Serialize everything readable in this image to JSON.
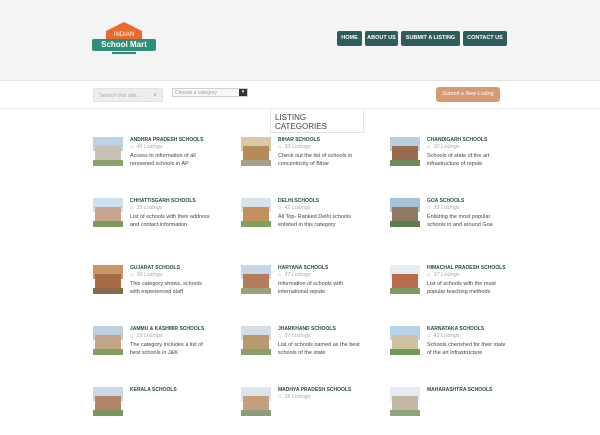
{
  "logo": {
    "line1": "INDIAN",
    "line2": "School Mart"
  },
  "nav": [
    {
      "label": "HOME"
    },
    {
      "label": "ABOUT US"
    },
    {
      "label": "SUBMIT A LISTING"
    },
    {
      "label": "CONTACT US"
    }
  ],
  "search": {
    "placeholder": "Search this site..."
  },
  "category_select": {
    "selected": "Choose a category"
  },
  "submit_button": "Submit a New Listing",
  "categories_title": "LISTING CATEGORIES",
  "icon": "tag-icon",
  "colors": {
    "nav_button": "#2f5b5b",
    "submit_button": "#d59a72",
    "heading": "#2a4a4a",
    "logo_green": "#2e8f78",
    "logo_orange": "#e86a2c"
  },
  "listings": [
    {
      "name": "ANDHRA PRADESH SCHOOLS",
      "count": "45 Listings",
      "desc": "Access to information of all renowned schools in AP"
    },
    {
      "name": "BIHAR SCHOOLS",
      "count": "33 Listings",
      "desc": "Check out the list of schools in concentricity of Bihar"
    },
    {
      "name": "CHANDIGARH SCHOOLS",
      "count": "30 Listings",
      "desc": "Schools of state of the art infrastructure of repute"
    },
    {
      "name": "CHHATTISGARH SCHOOLS",
      "count": "33 Listings",
      "desc": "List of schools with their address and contact information"
    },
    {
      "name": "DELHI SCHOOLS",
      "count": "42 Listings",
      "desc": "All Top- Ranked Delhi schools enlisted in this category"
    },
    {
      "name": "GOA SCHOOLS",
      "count": "33 Listings",
      "desc": "Enlisting the most popular schools in and around Goa"
    },
    {
      "name": "GUJARAT SCHOOLS",
      "count": "36 Listings",
      "desc": "This category shows, schools with experienced staff"
    },
    {
      "name": "HARYANA SCHOOLS",
      "count": "37 Listings",
      "desc": "Information of schools with international repute"
    },
    {
      "name": "HIMACHAL PRADESH SCHOOLS",
      "count": "37 Listings",
      "desc": "List of schools with the most popular teaching methods"
    },
    {
      "name": "JAMMU & KASHMIR SCHOOLS",
      "count": "33 Listings",
      "desc": "The category includes a list of best schools in J&K"
    },
    {
      "name": "JHARKHAND SCHOOLS",
      "count": "37 Listings",
      "desc": "List of schools named as the best schools of the state"
    },
    {
      "name": "KARNATAKA SCHOOLS",
      "count": "42 Listings",
      "desc": "Schools cherished for their state of the art infrastructure"
    },
    {
      "name": "KERALA SCHOOLS",
      "count": "",
      "desc": ""
    },
    {
      "name": "MADHYA PRADESH SCHOOLS",
      "count": "35 Listings",
      "desc": ""
    },
    {
      "name": "MAHARASHTRA SCHOOLS",
      "count": "",
      "desc": ""
    }
  ]
}
